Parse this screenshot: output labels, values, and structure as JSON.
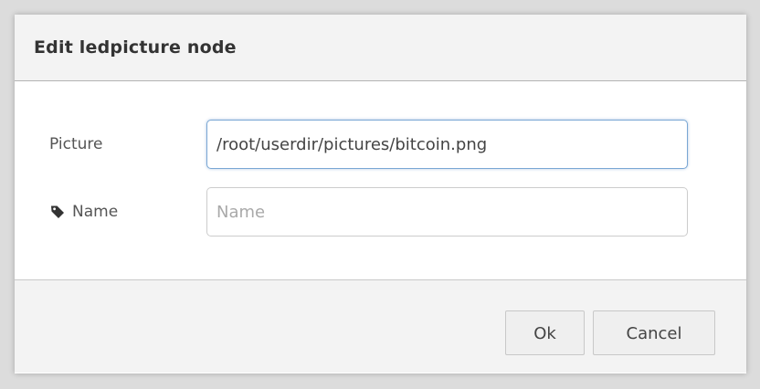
{
  "dialog": {
    "title": "Edit ledpicture node"
  },
  "form": {
    "picture": {
      "label": "Picture",
      "value": "/root/userdir/pictures/bitcoin.png"
    },
    "name": {
      "label": "Name",
      "icon": "tag-icon",
      "value": "",
      "placeholder": "Name"
    }
  },
  "footer": {
    "ok_label": "Ok",
    "cancel_label": "Cancel"
  }
}
